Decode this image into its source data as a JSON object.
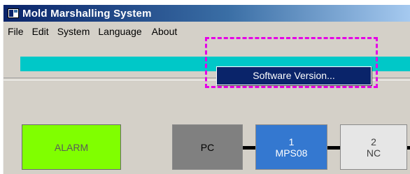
{
  "window": {
    "title": "Mold Marshalling System"
  },
  "menu": {
    "items": [
      "File",
      "Edit",
      "System",
      "Language",
      "About"
    ]
  },
  "about_menu": {
    "items": [
      "Software Version..."
    ]
  },
  "status_bar": {
    "color": "#00c8c8",
    "progress": 1.0
  },
  "alarm": {
    "label": "ALARM",
    "color": "#80ff00"
  },
  "nodes": [
    {
      "number": "",
      "label": "PC",
      "color": "#808080"
    },
    {
      "number": "1",
      "label": "MPS08",
      "color": "#3478d0"
    },
    {
      "number": "2",
      "label": "NC",
      "color": "#e6e6e6"
    }
  ],
  "highlight_color": "#e600e6"
}
